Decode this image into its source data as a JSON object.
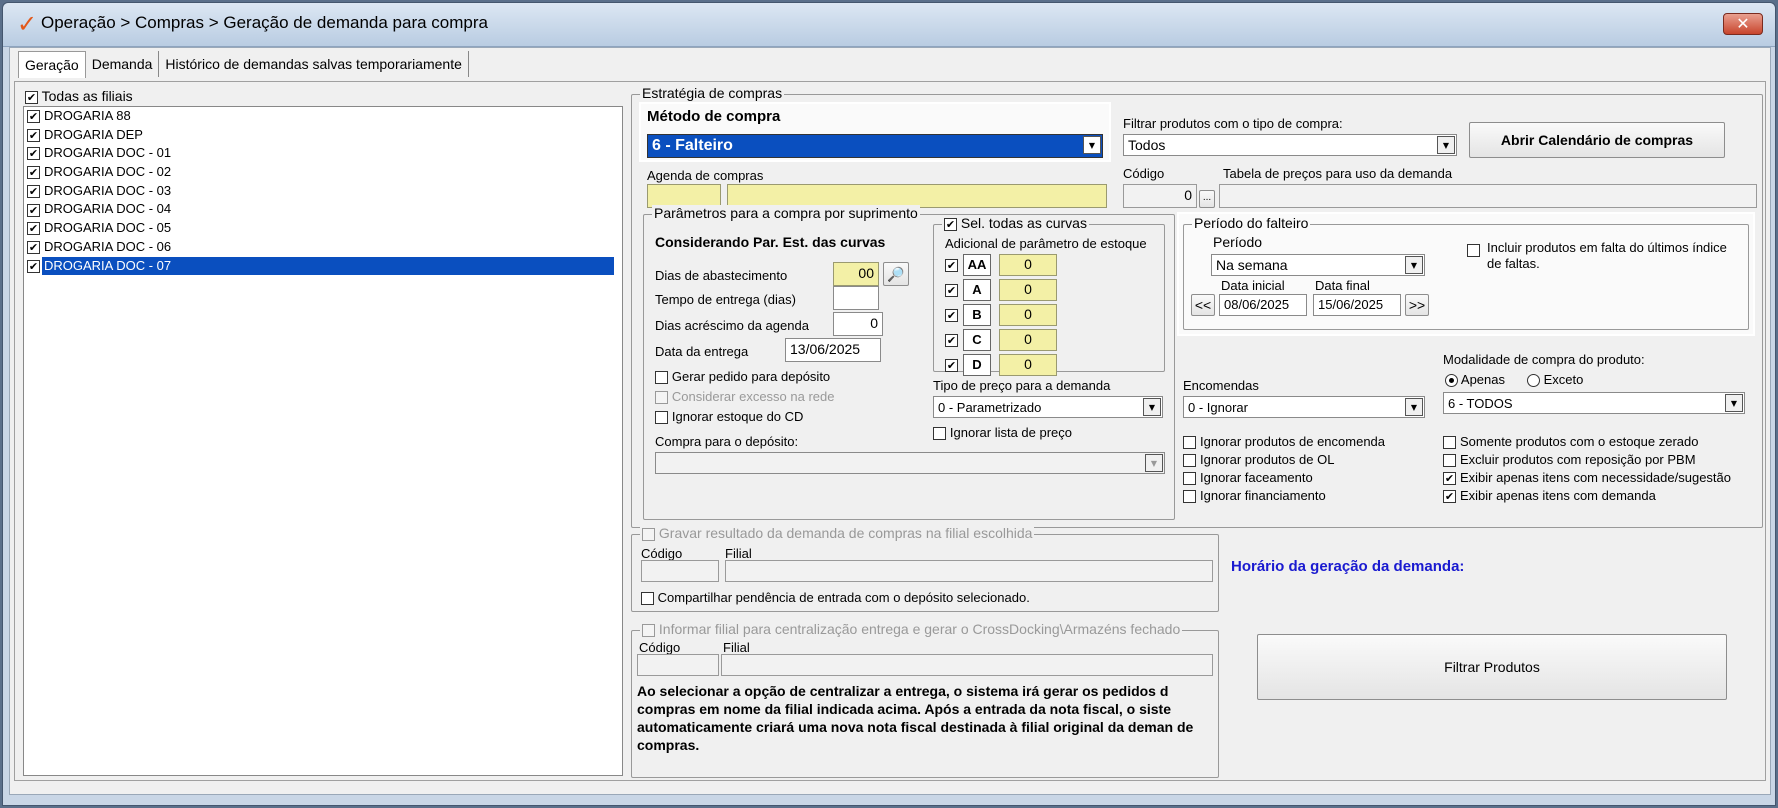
{
  "window": {
    "title": "Operação > Compras > Geração de demanda para compra",
    "close": "✕"
  },
  "tabs": [
    "Geração",
    "Demanda",
    "Histórico de demandas salvas temporariamente"
  ],
  "filiais": {
    "all_label": "Todas as filiais",
    "items": [
      "DROGARIA 88",
      "DROGARIA DEP",
      "DROGARIA DOC - 01",
      "DROGARIA DOC - 02",
      "DROGARIA DOC - 03",
      "DROGARIA DOC - 04",
      "DROGARIA DOC - 05",
      "DROGARIA DOC - 06",
      "DROGARIA DOC - 07"
    ]
  },
  "estrategia": {
    "title": "Estratégia de compras",
    "metodo_label": "Método de compra",
    "metodo_value": "6 - Falteiro",
    "agenda_label": "Agenda de compras",
    "filtrar_label": "Filtrar produtos com o tipo de compra:",
    "filtrar_value": "Todos",
    "calendario_btn": "Abrir Calendário de compras",
    "codigo_label": "Código",
    "codigo_value": "0",
    "tabela_label": "Tabela de preços para uso da demanda",
    "ellipsis": "...",
    "param": {
      "title": "Parâmetros para a compra por suprimento",
      "considerando": "Considerando Par. Est. das curvas",
      "dias_abast_label": "Dias de abastecimento",
      "dias_abast_value": "00",
      "tempo_label": "Tempo de entrega (dias)",
      "acrescimo_label": "Dias acréscimo da agenda",
      "acrescimo_value": "0",
      "data_label": "Data da entrega",
      "data_value": "13/06/2025",
      "gerar_pedido": "Gerar pedido para depósito",
      "considerar_excesso": "Considerar excesso na rede",
      "ignorar_estoque": "Ignorar estoque do CD",
      "compra_deposito": "Compra para o depósito:"
    },
    "curvas": {
      "title": "Sel. todas as curvas",
      "subtitle": "Adicional de parâmetro de estoque",
      "items": [
        {
          "name": "AA",
          "value": "0"
        },
        {
          "name": "A",
          "value": "0"
        },
        {
          "name": "B",
          "value": "0"
        },
        {
          "name": "C",
          "value": "0"
        },
        {
          "name": "D",
          "value": "0"
        }
      ]
    },
    "tipo_preco": {
      "label": "Tipo de preço para a demanda",
      "value": "0 - Parametrizado",
      "ignorar_lista": "Ignorar lista de preço"
    },
    "periodo": {
      "title": "Período do falteiro",
      "periodo_label": "Período",
      "periodo_value": "Na semana",
      "incluir_faltas": "Incluir produtos em falta do últimos índice de faltas.",
      "data_inicial_label": "Data inicial",
      "data_inicial_value": "08/06/2025",
      "data_final_label": "Data final",
      "data_final_value": "15/06/2025",
      "prev": "<<",
      "next": ">>"
    },
    "encomendas": {
      "label": "Encomendas",
      "value": "0 - Ignorar"
    },
    "modalidade": {
      "label": "Modalidade de compra do produto:",
      "apenas": "Apenas",
      "exceto": "Exceto",
      "value": "6 - TODOS"
    },
    "checks_left": [
      "Ignorar produtos de encomenda",
      "Ignorar produtos de OL",
      "Ignorar faceamento",
      "Ignorar financiamento"
    ],
    "checks_right": [
      "Somente produtos com o estoque zerado",
      "Excluir produtos com reposição por PBM",
      "Exibir apenas itens com necessidade/sugestão",
      "Exibir apenas itens com demanda"
    ]
  },
  "gravar": {
    "title": "Gravar resultado da demanda de compras na filial escolhida",
    "codigo": "Código",
    "filial": "Filial",
    "compartilhar": "Compartilhar pendência de entrada com o depósito selecionado."
  },
  "informar": {
    "title": "Informar filial para centralização entrega e gerar o CrossDocking\\Armazéns fechado",
    "codigo": "Código",
    "filial": "Filial",
    "note": "Ao selecionar a opção de centralizar a entrega, o sistema irá gerar os pedidos d compras em nome da filial indicada acima. Após a entrada da nota fiscal, o siste automaticamente criará uma nova nota fiscal destinada à filial original da deman de compras."
  },
  "horario_label": "Horário da geração da demanda:",
  "filtrar_btn": "Filtrar Produtos",
  "colors": {
    "highlight_blue": "#0a4fbf",
    "yellow_field": "#f3f0a6",
    "horario_blue": "#1a1ad0"
  }
}
